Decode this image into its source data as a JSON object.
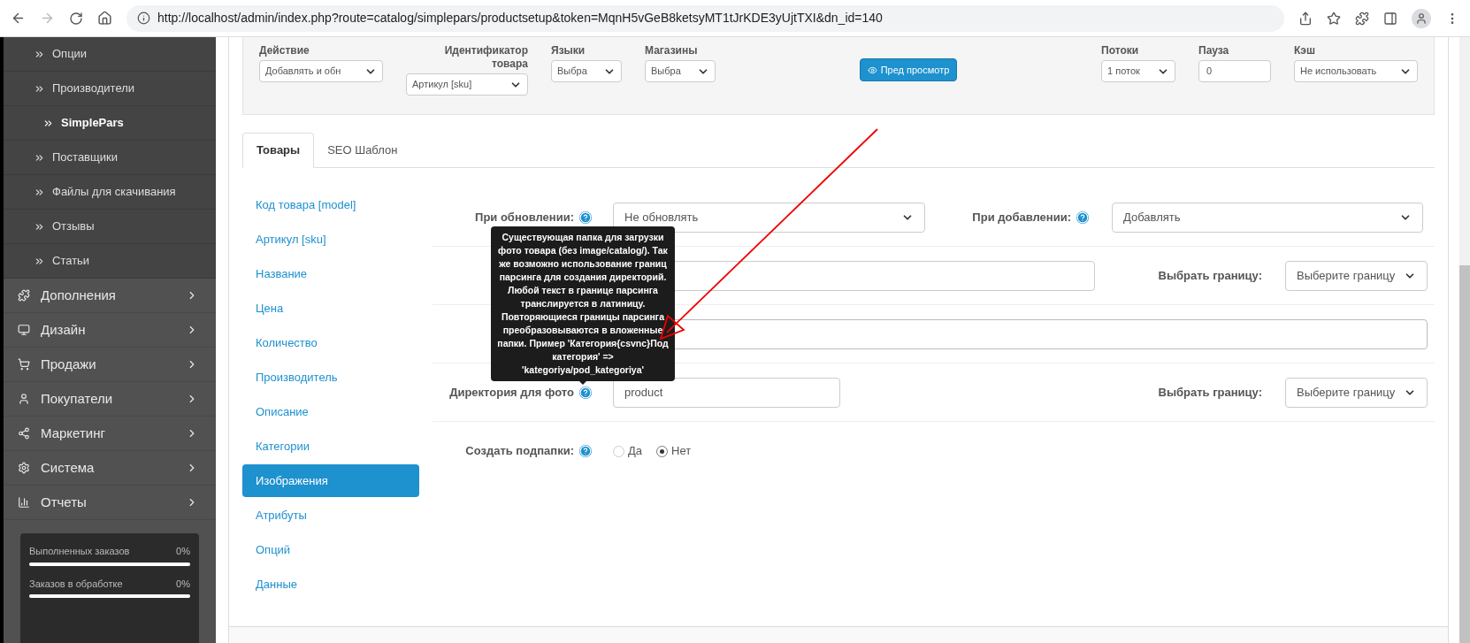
{
  "browser": {
    "url": "http://localhost/admin/index.php?route=catalog/simplepars/productsetup&token=MqnH5vGeB8ketsyMT1tJrKDE3yUjtTXI&dn_id=140"
  },
  "sidebar": {
    "items": [
      {
        "label": "Опции",
        "kind": "sub",
        "selected": false
      },
      {
        "label": "Производители",
        "kind": "sub",
        "selected": false
      },
      {
        "label": "SimplePars",
        "kind": "sub",
        "selected": true
      },
      {
        "label": "Поставщики",
        "kind": "sub",
        "selected": false
      },
      {
        "label": "Файлы для скачивания",
        "kind": "sub",
        "selected": false
      },
      {
        "label": "Отзывы",
        "kind": "sub",
        "selected": false
      },
      {
        "label": "Статьи",
        "kind": "sub",
        "selected": false
      },
      {
        "label": "Дополнения",
        "kind": "main",
        "selected": false
      },
      {
        "label": "Дизайн",
        "kind": "main",
        "selected": false
      },
      {
        "label": "Продажи",
        "kind": "main",
        "selected": false
      },
      {
        "label": "Покупатели",
        "kind": "main",
        "selected": false
      },
      {
        "label": "Маркетинг",
        "kind": "main",
        "selected": false
      },
      {
        "label": "Система",
        "kind": "main",
        "selected": false
      },
      {
        "label": "Отчеты",
        "kind": "main",
        "selected": false
      }
    ],
    "stats": [
      {
        "label": "Выполненных заказов",
        "value": "0%",
        "level": 1
      },
      {
        "label": "Заказов в обработке",
        "value": "0%",
        "level": 1
      }
    ]
  },
  "toolbar": [
    {
      "kind": "select",
      "label": "Действие",
      "value": "Добавлять и обн"
    },
    {
      "kind": "select",
      "label": "Идентификатор товара",
      "value": "Артикул [sku]"
    },
    {
      "kind": "select",
      "label": "Языки",
      "value": "Выбра"
    },
    {
      "kind": "select",
      "label": "Магазины",
      "value": "Выбра"
    },
    {
      "kind": "button",
      "value": "Пред просмотр"
    },
    {
      "kind": "select",
      "label": "Потоки",
      "value": "1 поток"
    },
    {
      "kind": "input",
      "label": "Пауза",
      "value": "0"
    },
    {
      "kind": "select",
      "label": "Кэш",
      "value": "Не использовать"
    }
  ],
  "tabs": [
    {
      "label": "Товары",
      "selected": true
    },
    {
      "label": "SEO Шаблон",
      "selected": false
    }
  ],
  "sections": [
    {
      "label": "Код товара [model]",
      "selected": false
    },
    {
      "label": "Артикул [sku]",
      "selected": false
    },
    {
      "label": "Название",
      "selected": false
    },
    {
      "label": "Цена",
      "selected": false
    },
    {
      "label": "Количество",
      "selected": false
    },
    {
      "label": "Производитель",
      "selected": false
    },
    {
      "label": "Описание",
      "selected": false
    },
    {
      "label": "Категории",
      "selected": false
    },
    {
      "label": "Изображения",
      "selected": true
    },
    {
      "label": "Атрибуты",
      "selected": false
    },
    {
      "label": "Опций",
      "selected": false
    },
    {
      "label": "Данные",
      "selected": false
    }
  ],
  "form": {
    "rows": [
      {
        "kind": "two_selects",
        "label": "При обновлении:",
        "value": "Не обновлять",
        "label2": "При добавлении:",
        "value2": "Добавлять"
      },
      {
        "kind": "input_border",
        "value2": "Выберите границу",
        "label2": "Выбрать границу:"
      },
      {
        "kind": "wide_input"
      },
      {
        "kind": "input_border",
        "label": "Директория для фото",
        "value": "product",
        "label2": "Выбрать границу:",
        "value2": "Выберите границу"
      },
      {
        "kind": "radios",
        "label": "Создать подпапки:",
        "options": [
          {
            "label": "Да",
            "selected": false
          },
          {
            "label": "Нет",
            "selected": true
          }
        ]
      }
    ]
  },
  "tooltip": "Существующая папка для загрузки фото товара (без image/catalog/). Так же возможно использование границ парсинга для создания директорий. Любой текст в границе парсинга транслируется в латиницу. Повторяющиеся границы парсинга преобразовываются в вложенные папки. Пример 'Категория{csvnc}Под категория' => 'kategoriya/pod_kategoriya'"
}
